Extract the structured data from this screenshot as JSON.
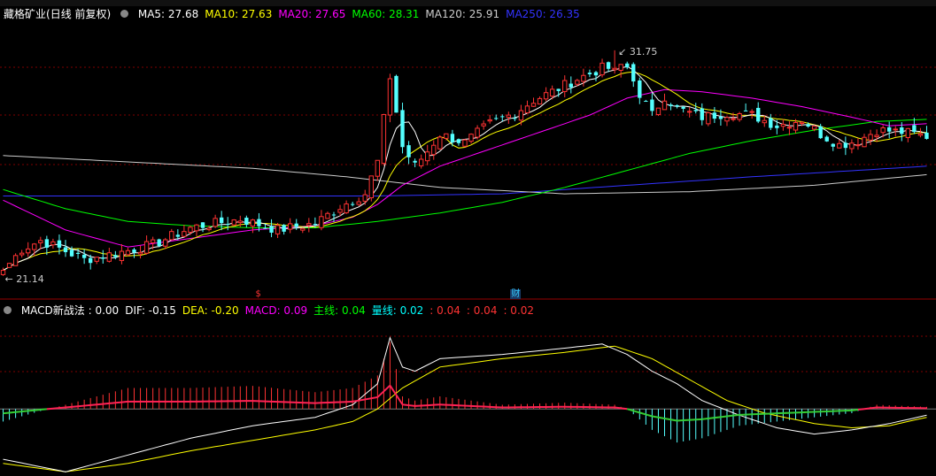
{
  "stock": {
    "name": "藏格矿业",
    "period": "(日线 前复权)"
  },
  "ma_legend": [
    {
      "label": "MA5: 27.68",
      "color": "#ffffff"
    },
    {
      "label": "MA10: 27.63",
      "color": "#ffff00"
    },
    {
      "label": "MA20: 27.65",
      "color": "#ff00ff"
    },
    {
      "label": "MA60: 28.31",
      "color": "#00ff00"
    },
    {
      "label": "MA120: 25.91",
      "color": "#cccccc"
    },
    {
      "label": "MA250: 26.35",
      "color": "#3333ff"
    }
  ],
  "macd_legend": [
    {
      "label": "MACD新战法 : 0.00",
      "color": "#ffffff"
    },
    {
      "label": "DIF: -0.15",
      "color": "#ffffff"
    },
    {
      "label": "DEA: -0.20",
      "color": "#ffff00"
    },
    {
      "label": "MACD: 0.09",
      "color": "#ff00ff"
    },
    {
      "label": "主线: 0.04",
      "color": "#00ff00"
    },
    {
      "label": "量线: 0.02",
      "color": "#00ffff"
    },
    {
      "label": ": 0.04",
      "color": "#ff3333"
    },
    {
      "label": ": 0.04",
      "color": "#ff3333"
    },
    {
      "label": ": 0.02",
      "color": "#ff3333"
    }
  ],
  "annotations": {
    "high_label": "31.75",
    "low_label": "21.14",
    "event_markers": [
      {
        "label": "$",
        "color": "#ff3333",
        "index": 41
      },
      {
        "label": "财",
        "color": "#33ccff",
        "index": 82
      }
    ]
  },
  "colors": {
    "up": "#ff3333",
    "down": "#54ffff",
    "grid": "#800000",
    "ma5": "#ffffff",
    "ma10": "#ffff00",
    "ma20": "#ff00ff",
    "ma60": "#00ff00",
    "ma120": "#cccccc",
    "ma250": "#3333ff"
  },
  "chart_data": {
    "type": "candlestick",
    "price_ylim": [
      20.3,
      33.2
    ],
    "high_value": 31.75,
    "high_index": 98,
    "low_value": 21.14,
    "low_index": 0,
    "close_anchors": [
      [
        0,
        21.4
      ],
      [
        3,
        22.4
      ],
      [
        6,
        22.8
      ],
      [
        10,
        22.3
      ],
      [
        13,
        21.9
      ],
      [
        18,
        22.2
      ],
      [
        24,
        22.6
      ],
      [
        30,
        23.4
      ],
      [
        34,
        23.6
      ],
      [
        38,
        23.8
      ],
      [
        44,
        23.3
      ],
      [
        50,
        23.6
      ],
      [
        54,
        24.4
      ],
      [
        58,
        25.0
      ],
      [
        60,
        26.5
      ],
      [
        62,
        30.5
      ],
      [
        64,
        27.2
      ],
      [
        66,
        26.3
      ],
      [
        68,
        27.0
      ],
      [
        70,
        27.8
      ],
      [
        74,
        27.4
      ],
      [
        78,
        28.3
      ],
      [
        82,
        28.8
      ],
      [
        85,
        29.4
      ],
      [
        88,
        29.8
      ],
      [
        92,
        30.4
      ],
      [
        96,
        30.9
      ],
      [
        100,
        30.9
      ],
      [
        102,
        29.7
      ],
      [
        104,
        28.7
      ],
      [
        106,
        29.6
      ],
      [
        108,
        29.0
      ],
      [
        112,
        28.6
      ],
      [
        116,
        28.8
      ],
      [
        120,
        28.7
      ],
      [
        124,
        28.2
      ],
      [
        128,
        28.5
      ],
      [
        131,
        27.8
      ],
      [
        134,
        27.3
      ],
      [
        137,
        27.5
      ],
      [
        140,
        28.0
      ],
      [
        144,
        27.9
      ],
      [
        148,
        27.7
      ]
    ],
    "ma_anchors": {
      "ma20": [
        [
          0,
          24.7
        ],
        [
          10,
          23.3
        ],
        [
          20,
          22.5
        ],
        [
          30,
          22.9
        ],
        [
          40,
          23.3
        ],
        [
          50,
          23.5
        ],
        [
          56,
          23.9
        ],
        [
          60,
          24.5
        ],
        [
          64,
          25.4
        ],
        [
          70,
          26.3
        ],
        [
          78,
          27.1
        ],
        [
          86,
          27.9
        ],
        [
          94,
          28.7
        ],
        [
          100,
          29.5
        ],
        [
          106,
          29.9
        ],
        [
          112,
          29.8
        ],
        [
          120,
          29.5
        ],
        [
          128,
          29.1
        ],
        [
          136,
          28.6
        ],
        [
          142,
          28.2
        ],
        [
          148,
          28.3
        ]
      ],
      "ma60": [
        [
          0,
          25.2
        ],
        [
          10,
          24.3
        ],
        [
          20,
          23.7
        ],
        [
          30,
          23.5
        ],
        [
          40,
          23.4
        ],
        [
          50,
          23.4
        ],
        [
          60,
          23.7
        ],
        [
          70,
          24.1
        ],
        [
          80,
          24.6
        ],
        [
          90,
          25.3
        ],
        [
          100,
          26.1
        ],
        [
          110,
          26.9
        ],
        [
          120,
          27.5
        ],
        [
          130,
          28.0
        ],
        [
          140,
          28.4
        ],
        [
          148,
          28.5
        ]
      ],
      "ma120": [
        [
          0,
          26.8
        ],
        [
          20,
          26.5
        ],
        [
          40,
          26.2
        ],
        [
          55,
          25.8
        ],
        [
          70,
          25.3
        ],
        [
          90,
          25.0
        ],
        [
          110,
          25.1
        ],
        [
          130,
          25.4
        ],
        [
          148,
          25.9
        ]
      ],
      "ma250": [
        [
          0,
          24.9
        ],
        [
          30,
          24.9
        ],
        [
          60,
          24.9
        ],
        [
          80,
          25.0
        ],
        [
          100,
          25.4
        ],
        [
          120,
          25.8
        ],
        [
          148,
          26.3
        ]
      ]
    },
    "macd_ylim": [
      -1.6,
      2.2
    ],
    "dif_anchors": [
      [
        0,
        -1.2
      ],
      [
        10,
        -1.5
      ],
      [
        20,
        -1.1
      ],
      [
        30,
        -0.7
      ],
      [
        40,
        -0.4
      ],
      [
        50,
        -0.2
      ],
      [
        56,
        0.1
      ],
      [
        60,
        0.6
      ],
      [
        62,
        1.7
      ],
      [
        64,
        1.0
      ],
      [
        66,
        0.9
      ],
      [
        70,
        1.2
      ],
      [
        80,
        1.3
      ],
      [
        90,
        1.45
      ],
      [
        96,
        1.55
      ],
      [
        100,
        1.3
      ],
      [
        104,
        0.9
      ],
      [
        108,
        0.6
      ],
      [
        112,
        0.2
      ],
      [
        118,
        -0.15
      ],
      [
        124,
        -0.45
      ],
      [
        130,
        -0.6
      ],
      [
        136,
        -0.5
      ],
      [
        142,
        -0.35
      ],
      [
        148,
        -0.15
      ]
    ],
    "dea_anchors": [
      [
        0,
        -1.3
      ],
      [
        10,
        -1.5
      ],
      [
        20,
        -1.3
      ],
      [
        30,
        -1.0
      ],
      [
        40,
        -0.75
      ],
      [
        50,
        -0.5
      ],
      [
        56,
        -0.3
      ],
      [
        60,
        0.0
      ],
      [
        64,
        0.5
      ],
      [
        70,
        1.0
      ],
      [
        80,
        1.2
      ],
      [
        90,
        1.35
      ],
      [
        98,
        1.5
      ],
      [
        104,
        1.2
      ],
      [
        110,
        0.7
      ],
      [
        116,
        0.2
      ],
      [
        122,
        -0.1
      ],
      [
        130,
        -0.35
      ],
      [
        136,
        -0.45
      ],
      [
        142,
        -0.4
      ],
      [
        148,
        -0.2
      ]
    ],
    "hist_anchors": [
      [
        0,
        -0.3
      ],
      [
        6,
        -0.05
      ],
      [
        10,
        0.1
      ],
      [
        20,
        0.5
      ],
      [
        30,
        0.5
      ],
      [
        40,
        0.55
      ],
      [
        50,
        0.4
      ],
      [
        56,
        0.5
      ],
      [
        60,
        0.8
      ],
      [
        62,
        1.6
      ],
      [
        64,
        0.3
      ],
      [
        66,
        0.2
      ],
      [
        70,
        0.3
      ],
      [
        80,
        0.1
      ],
      [
        90,
        0.15
      ],
      [
        98,
        0.1
      ],
      [
        100,
        0.0
      ],
      [
        104,
        -0.5
      ],
      [
        108,
        -0.8
      ],
      [
        112,
        -0.7
      ],
      [
        118,
        -0.4
      ],
      [
        124,
        -0.3
      ],
      [
        130,
        -0.2
      ],
      [
        136,
        -0.1
      ],
      [
        140,
        0.1
      ],
      [
        148,
        0.05
      ]
    ],
    "count": 149
  }
}
